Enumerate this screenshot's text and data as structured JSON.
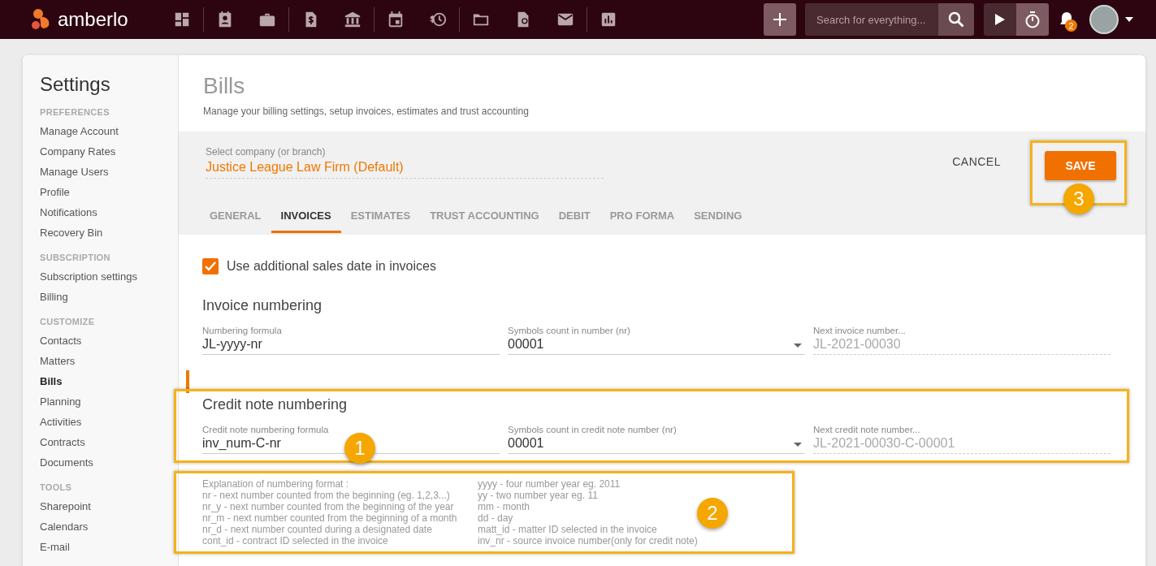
{
  "topbar": {
    "logo": "amberlo",
    "nav_icons": [
      {
        "kind": "dashboard",
        "divider": true
      },
      {
        "kind": "contact",
        "divider": false
      },
      {
        "kind": "briefcase",
        "divider": true
      },
      {
        "kind": "dollar-doc",
        "divider": false
      },
      {
        "kind": "bank",
        "divider": true
      },
      {
        "kind": "calendar",
        "divider": false
      },
      {
        "kind": "dollar-clock",
        "divider": true
      },
      {
        "kind": "folder",
        "divider": false
      },
      {
        "kind": "certificate",
        "divider": false
      },
      {
        "kind": "mail",
        "divider": true
      },
      {
        "kind": "chart",
        "divider": false
      }
    ],
    "search": {
      "placeholder": "Search for everything..."
    },
    "notifications": {
      "count": "2"
    }
  },
  "sidebar": {
    "title": "Settings",
    "sections": [
      {
        "heading": "PREFERENCES",
        "items": [
          {
            "label": "Manage Account",
            "selected": false
          },
          {
            "label": "Company Rates",
            "selected": false
          },
          {
            "label": "Manage Users",
            "selected": false
          },
          {
            "label": "Profile",
            "selected": false
          },
          {
            "label": "Notifications",
            "selected": false
          },
          {
            "label": "Recovery Bin",
            "selected": false
          }
        ]
      },
      {
        "heading": "SUBSCRIPTION",
        "items": [
          {
            "label": "Subscription settings",
            "selected": false
          },
          {
            "label": "Billing",
            "selected": false
          }
        ]
      },
      {
        "heading": "CUSTOMIZE",
        "items": [
          {
            "label": "Contacts",
            "selected": false
          },
          {
            "label": "Matters",
            "selected": false
          },
          {
            "label": "Bills",
            "selected": true
          },
          {
            "label": "Planning",
            "selected": false
          },
          {
            "label": "Activities",
            "selected": false
          },
          {
            "label": "Contracts",
            "selected": false
          },
          {
            "label": "Documents",
            "selected": false
          }
        ]
      },
      {
        "heading": "TOOLS",
        "items": [
          {
            "label": "Sharepoint",
            "selected": false
          },
          {
            "label": "Calendars",
            "selected": false
          },
          {
            "label": "E-mail",
            "selected": false
          }
        ]
      }
    ]
  },
  "page": {
    "title": "Bills",
    "subtitle": "Manage your billing settings, setup invoices, estimates and trust accounting",
    "company": {
      "label": "Select company (or branch)",
      "value": "Justice League Law Firm (Default)"
    },
    "actions": {
      "cancel": "CANCEL",
      "save": "SAVE",
      "annotation": "3"
    },
    "tabs": [
      {
        "label": "GENERAL",
        "selected": false
      },
      {
        "label": "INVOICES",
        "selected": true
      },
      {
        "label": "ESTIMATES",
        "selected": false
      },
      {
        "label": "TRUST ACCOUNTING",
        "selected": false
      },
      {
        "label": "DEBIT",
        "selected": false
      },
      {
        "label": "PRO FORMA",
        "selected": false
      },
      {
        "label": "SENDING",
        "selected": false
      }
    ],
    "sales_date": {
      "label": "Use additional sales date in invoices",
      "checked": true
    },
    "sections": [
      {
        "title": "Invoice numbering",
        "fields": [
          {
            "kind": "text",
            "label": "Numbering formula",
            "value": "JL-yyyy-nr"
          },
          {
            "kind": "select",
            "label": "Symbols count in number (nr)",
            "value": "00001"
          },
          {
            "kind": "readonly",
            "label": "Next invoice number...",
            "value": "JL-2021-00030"
          }
        ]
      },
      {
        "title": "Credit note numbering",
        "annotation": "1",
        "fields": [
          {
            "kind": "text",
            "label": "Credit note numbering formula",
            "value": "inv_num-C-nr"
          },
          {
            "kind": "select",
            "label": "Symbols count in credit note number (nr)",
            "value": "00001"
          },
          {
            "kind": "readonly",
            "label": "Next credit note number...",
            "value": "JL-2021-00030-C-00001"
          }
        ]
      }
    ],
    "explanation": {
      "annotation": "2",
      "columns": [
        [
          "Explanation of numbering format :",
          "nr - next number counted from the beginning (eg. 1,2,3...)",
          "nr_y - next number counted from the beginning of the year",
          "nr_m - next number counted from the beginning of a month",
          "nr_d - next number counted during a designated date",
          "cont_id - contract ID selected in the invoice"
        ],
        [
          "yyyy - four number year eg. 2011",
          "yy - two number year eg. 11",
          "mm - month",
          "dd - day",
          "matt_id - matter ID selected in the invoice",
          "inv_nr - source invoice number(only for credit note)"
        ]
      ]
    }
  }
}
